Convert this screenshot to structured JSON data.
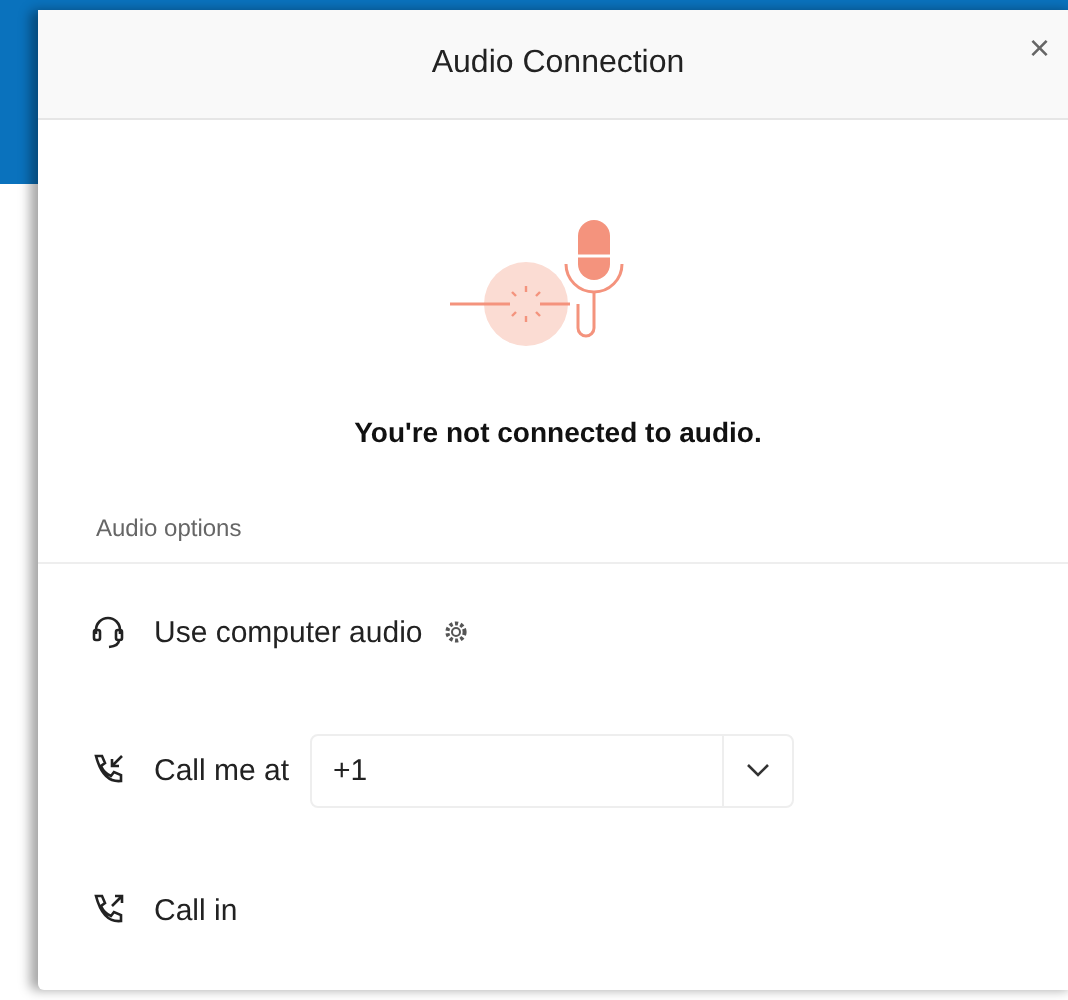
{
  "dialog": {
    "title": "Audio Connection",
    "close": "×"
  },
  "status": {
    "message": "You're not connected to audio."
  },
  "section": {
    "heading": "Audio options"
  },
  "options": [
    {
      "kind": "computer_audio",
      "label": "Use computer audio"
    },
    {
      "kind": "call_me",
      "label": "Call me at",
      "value": "+1"
    },
    {
      "kind": "call_in",
      "label": "Call in"
    }
  ]
}
